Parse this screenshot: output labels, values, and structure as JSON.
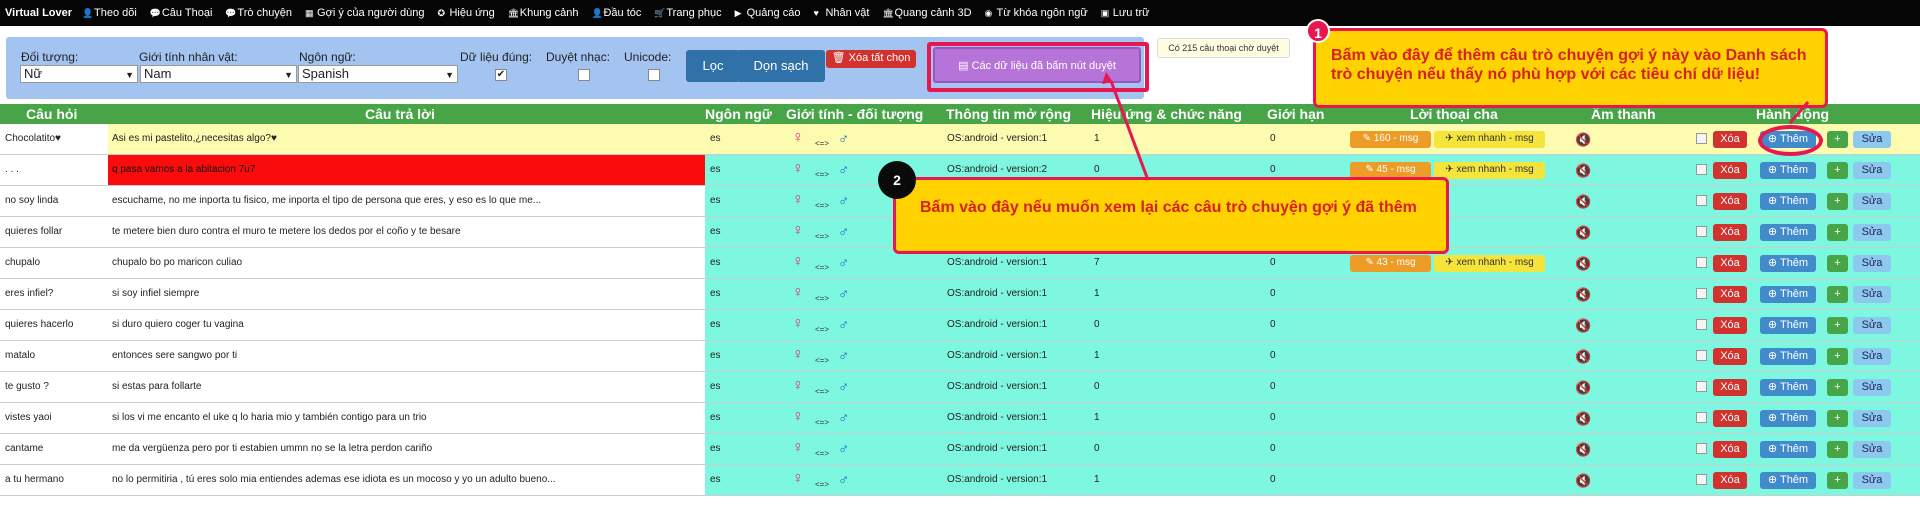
{
  "nav": {
    "brand": "Virtual Lover",
    "items": [
      {
        "label": "Theo dõi",
        "icon": "user-icon"
      },
      {
        "label": "Câu Thoại",
        "icon": "comment-icon"
      },
      {
        "label": "Trò chuyện",
        "icon": "comments-icon"
      },
      {
        "label": "Gợi ý của người dùng",
        "icon": "list-icon"
      },
      {
        "label": "Hiệu ứng",
        "icon": "star-icon"
      },
      {
        "label": "Khung cảnh",
        "icon": "bank-icon"
      },
      {
        "label": "Đầu tóc",
        "icon": "hair-icon"
      },
      {
        "label": "Trang phục",
        "icon": "shirt-icon"
      },
      {
        "label": "Quảng cáo",
        "icon": "play-icon"
      },
      {
        "label": "Nhân vật",
        "icon": "heart-icon"
      },
      {
        "label": "Quang cảnh 3D",
        "icon": "bank3d-icon"
      },
      {
        "label": "Từ khóa ngôn ngữ",
        "icon": "globe-icon"
      },
      {
        "label": "Lưu trữ",
        "icon": "save-icon"
      }
    ]
  },
  "filter": {
    "subject_label": "Đối tượng:",
    "subject_value": "Nữ",
    "gender_label": "Giới tính nhân vật:",
    "gender_value": "Nam",
    "lang_label": "Ngôn ngữ:",
    "lang_value": "Spanish",
    "valid_label": "Dữ liệu đúng:",
    "music_label": "Duyệt nhạc:",
    "unicode_label": "Unicode:",
    "valid_checked": true,
    "music_checked": false,
    "unicode_checked": false,
    "filter_button": "Lọc",
    "clear_button": "Dọn sạch",
    "delete_all_button": "Xóa tất chọn",
    "approved_button": "Các dữ liệu đã bấm nút duyệt",
    "pending_text": "Có 215 câu thoại chờ duyệt"
  },
  "callouts": {
    "one_number": "1",
    "one_text": "Bấm vào đây để thêm câu trò chuyện gợi ý này vào Danh sách trò chuyện nếu thấy nó phù hợp với các tiêu chí dữ liệu!",
    "two_number": "2",
    "two_text": "Bấm vào đây nếu muốn xem lại các câu trò chuyện gợi ý đã thêm"
  },
  "table": {
    "headers": {
      "question": "Câu hỏi",
      "answer": "Câu trả lời",
      "language": "Ngôn ngữ",
      "gender": "Giới tính - đối tượng",
      "info": "Thông tin mở rộng",
      "effect": "Hiệu ứng & chức năng",
      "limit": "Giới hạn",
      "parent": "Lời thoại cha",
      "sound": "Âm thanh",
      "action": "Hành động"
    },
    "buttons": {
      "delete": "Xóa",
      "add": "Thêm",
      "edit": "Sửa",
      "quick": "xem nhanh - msg"
    },
    "rows": [
      {
        "q": "Chocolatito♥",
        "a": "Asi es mi pastelito,¿necesitas algo?♥",
        "lang": "es",
        "os": "OS:android - version:1",
        "effect": "1",
        "limit": "0",
        "parent": "160 - msg",
        "highlight": "yellow"
      },
      {
        "q": ". . .",
        "a": "q pasa vamos a la abitacion 7u7",
        "lang": "es",
        "os": "OS:android - version:2",
        "effect": "0",
        "limit": "0",
        "parent": "45 - msg",
        "highlight": "red"
      },
      {
        "q": "no soy linda",
        "a": "escuchame, no me inporta tu fisico, me inporta el tipo de persona que eres, y eso es lo que me...",
        "lang": "es",
        "os": "",
        "effect": "",
        "limit": "",
        "parent": "",
        "highlight": ""
      },
      {
        "q": "quieres follar",
        "a": "te metere bien duro contra el muro te metere los dedos por el coño y te besare",
        "lang": "es",
        "os": "",
        "effect": "",
        "limit": "",
        "parent": "",
        "highlight": ""
      },
      {
        "q": "chupalo",
        "a": "chupalo bo po maricon culiao",
        "lang": "es",
        "os": "OS:android - version:1",
        "effect": "7",
        "limit": "0",
        "parent": "43 - msg",
        "highlight": ""
      },
      {
        "q": "eres infiel?",
        "a": "si soy infiel siempre",
        "lang": "es",
        "os": "OS:android - version:1",
        "effect": "1",
        "limit": "0",
        "parent": "",
        "highlight": ""
      },
      {
        "q": "quieres hacerlo",
        "a": "si duro quiero coger tu vagina",
        "lang": "es",
        "os": "OS:android - version:1",
        "effect": "0",
        "limit": "0",
        "parent": "",
        "highlight": ""
      },
      {
        "q": "matalo",
        "a": "entonces sere sangwo por ti",
        "lang": "es",
        "os": "OS:android - version:1",
        "effect": "1",
        "limit": "0",
        "parent": "",
        "highlight": ""
      },
      {
        "q": "te gusto ?",
        "a": "si estas para follarte",
        "lang": "es",
        "os": "OS:android - version:1",
        "effect": "0",
        "limit": "0",
        "parent": "",
        "highlight": ""
      },
      {
        "q": "vistes yaoi",
        "a": "si los vi me encanto el uke q lo haria mio y también contigo para un trio",
        "lang": "es",
        "os": "OS:android - version:1",
        "effect": "1",
        "limit": "0",
        "parent": "",
        "highlight": ""
      },
      {
        "q": "cantame",
        "a": "me da vergüenza pero por ti estabien ummn no se la letra perdon cariño",
        "lang": "es",
        "os": "OS:android - version:1",
        "effect": "0",
        "limit": "0",
        "parent": "",
        "highlight": ""
      },
      {
        "q": "a tu hermano",
        "a": "no lo permitiria , tú eres solo mia entiendes ademas ese idiota es un mocoso y yo un adulto bueno...",
        "lang": "es",
        "os": "OS:android - version:1",
        "effect": "1",
        "limit": "0",
        "parent": "",
        "highlight": ""
      }
    ]
  }
}
